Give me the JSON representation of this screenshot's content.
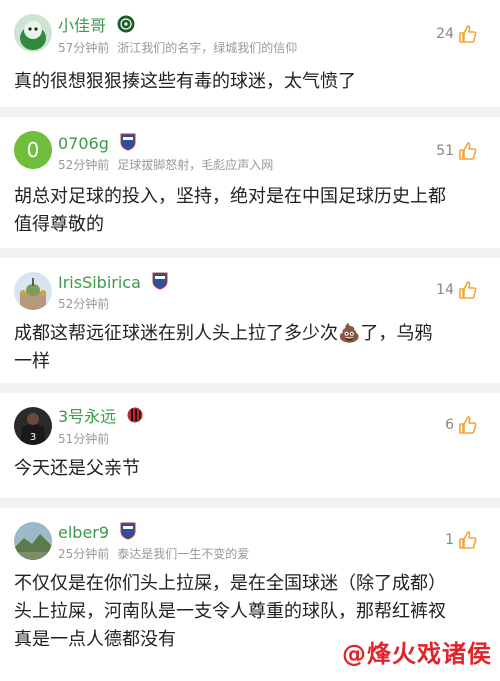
{
  "comments": [
    {
      "username": "小佳哥",
      "time": "57分钟前",
      "signature": "浙江我们的名字，绿城我们的信仰",
      "likes": "24",
      "text_lines": [
        "真的很想狠狠揍这些有毒的球迷，太气愤了"
      ],
      "avatar_icon": "mascot-avatar",
      "badge_icon": "green-club-badge"
    },
    {
      "username": "0706g",
      "time": "52分钟前",
      "signature": "足球拔脚怒射，毛彪应声入网",
      "likes": "51",
      "text_lines": [
        "胡总对足球的投入，坚持，绝对是在中国足球历史上都",
        "值得尊敬的"
      ],
      "avatar_icon": "letter-avatar",
      "avatar_letter": "0",
      "badge_icon": "shield-badge"
    },
    {
      "username": "IrisSibirica",
      "time": "52分钟前",
      "signature": "",
      "likes": "14",
      "text_lines": [
        "成都这帮远征球迷在别人头上拉了多少次💩了，乌鸦",
        "一样"
      ],
      "avatar_icon": "church-avatar",
      "badge_icon": "shield-badge"
    },
    {
      "username": "3号永远",
      "time": "51分钟前",
      "signature": "",
      "likes": "6",
      "text_lines": [
        "今天还是父亲节"
      ],
      "avatar_icon": "jersey-avatar",
      "badge_icon": "red-black-badge"
    },
    {
      "username": "elber9",
      "time": "25分钟前",
      "signature": "泰达是我们一生不变的爱",
      "likes": "1",
      "text_lines": [
        "不仅仅是在你们头上拉屎，是在全国球迷（除了成都）",
        "头上拉屎，河南队是一支令人尊重的球队，那帮红裤衩",
        "真是一点人德都没有"
      ],
      "avatar_icon": "landscape-avatar",
      "badge_icon": "shield-badge"
    }
  ],
  "watermark": "@烽火戏诸侯",
  "colors": {
    "username": "#3a9b48",
    "meta": "#999999",
    "thumb": "#f2a53a",
    "watermark": "#e0242b"
  }
}
